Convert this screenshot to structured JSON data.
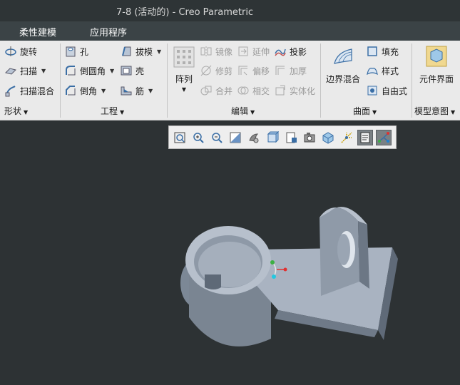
{
  "window": {
    "title": "7-8 (活动的) - Creo Parametric"
  },
  "menubar": {
    "tabs": [
      "柔性建模",
      "应用程序"
    ]
  },
  "ribbon": {
    "shape": {
      "items": [
        "旋转",
        "扫描",
        "扫描混合"
      ],
      "label": "形状"
    },
    "engineering": {
      "items": [
        "孔",
        "倒圆角",
        "倒角",
        "拔模",
        "壳",
        "筋"
      ],
      "label": "工程"
    },
    "editing": {
      "pattern": "阵列",
      "items": [
        "镜像",
        "延伸",
        "投影",
        "修剪",
        "偏移",
        "加厚",
        "合并",
        "相交",
        "实体化"
      ],
      "label": "编辑"
    },
    "surfaces": {
      "items": [
        "边界混合",
        "填充",
        "样式",
        "自由式"
      ],
      "label": "曲面"
    },
    "model_intent": {
      "items": [
        "元件界面"
      ],
      "label": "模型意图"
    }
  },
  "view_toolbar": {
    "buttons": [
      "refit-icon",
      "zoom-in-icon",
      "zoom-out-icon",
      "repaint-icon",
      "display-style-icon",
      "saved-views-icon",
      "view-manager-icon",
      "perspective-icon",
      "datum-display-icon",
      "spin-center-icon",
      "annotation-display-icon",
      "3d-dragger-icon"
    ]
  },
  "colors": {
    "titlebar": "#2e3436",
    "menubar": "#3b4346",
    "ribbon": "#eaeaea",
    "viewport": "#2d3234",
    "model": "#aab4c2"
  }
}
